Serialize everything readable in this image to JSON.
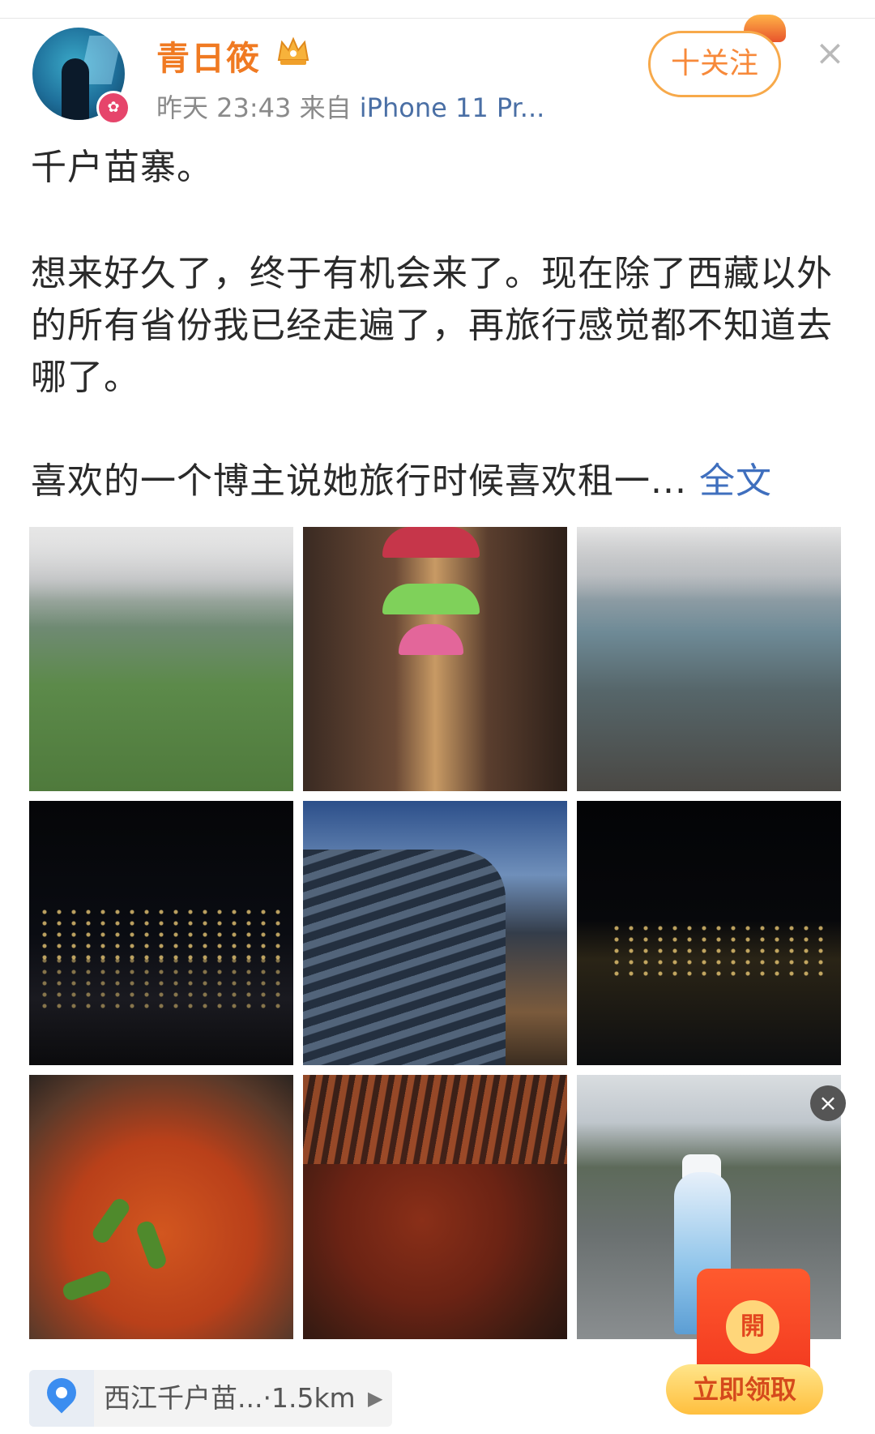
{
  "post": {
    "author": "青日筱",
    "time": "昨天 23:43",
    "source_prefix": "来自",
    "device": "iPhone 11 Pr...",
    "follow_label": "十关注",
    "close_label": "×",
    "text_title": "千户苗寨。",
    "text_body": "想来好久了，终于有机会来了。现在除了西藏以外的所有省份我已经走遍了，再旅行感觉都不知道去哪了。",
    "text_preview": "喜欢的一个博主说她旅行时候喜欢租一...",
    "full_text_link": "全文"
  },
  "images": [
    {
      "icon": "terraced-hills-photo"
    },
    {
      "icon": "alley-with-umbrellas-photo"
    },
    {
      "icon": "mountain-valley-village-photo"
    },
    {
      "icon": "night-village-lights-photo"
    },
    {
      "icon": "tiled-roof-photo"
    },
    {
      "icon": "night-riverside-photo"
    },
    {
      "icon": "fish-soup-photo"
    },
    {
      "icon": "grilled-skewers-photo"
    },
    {
      "icon": "dancer-costume-photo"
    }
  ],
  "location": {
    "text": "西江千户苗...·1.5km",
    "arrow": "▶"
  },
  "promo": {
    "coin_text": "開",
    "button_label": "立即领取"
  },
  "colors": {
    "username": "#f07a22",
    "link": "#3f6fbe",
    "follow_border": "#f7a94a",
    "promo_red": "#f2381f"
  }
}
